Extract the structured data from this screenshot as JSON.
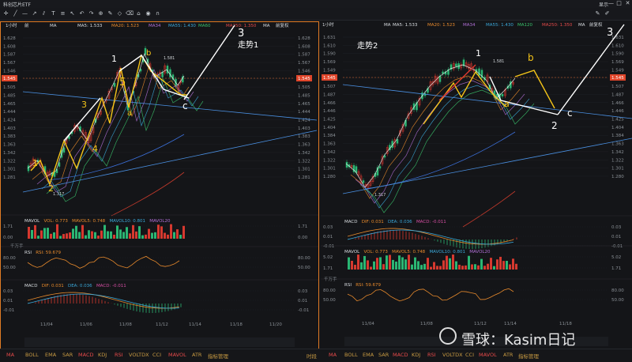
{
  "window": {
    "title": "科创芯片ETF",
    "right_label": "显示",
    "controls": [
      "—",
      "□",
      "✕"
    ]
  },
  "toolbar": {
    "icons": [
      "crosshair-icon",
      "line-icon",
      "horizontal-line-icon",
      "ray-icon",
      "parallel-icon",
      "text-icon",
      "fib-icon",
      "arrow-icon",
      "undo-icon",
      "redo-icon",
      "zoom-icon",
      "pen-icon",
      "shape-icon",
      "delete-icon",
      "lock-icon",
      "eye-icon",
      "magnet-icon"
    ]
  },
  "left": {
    "period": "1小时",
    "adj": "前",
    "ma_label": "MA",
    "ma5": "MA5: 1.533",
    "ma20": "MA20: 1.523",
    "ma34": "MA34",
    "ma55": "MA55: 1.430",
    "ma60": "MA60",
    "ma250": "MA250: 1.350",
    "ma_adj": "MA",
    "adj_label": "前复权",
    "title": "走势1",
    "price_ticks": [
      "1.628",
      "1.608",
      "1.587",
      "1.567",
      "1.546",
      "1.526",
      "1.505",
      "1.485",
      "1.465",
      "1.444",
      "1.424",
      "1.403",
      "1.383",
      "1.363",
      "1.342",
      "1.322",
      "1.301",
      "1.281"
    ],
    "last_price": "1.545",
    "high_label": "1.581",
    "low_label": "1.317",
    "wave_labels": [
      "1",
      "2",
      "3",
      "4",
      "5",
      "a",
      "b",
      "c",
      "3"
    ],
    "mavol": {
      "name": "MAVOL",
      "vol": "VOL: 0.773",
      "ma5": "MAVOL5: 0.748",
      "ma10": "MAVOL10: 0.801",
      "ma20": "MAVOL20",
      "ticks": [
        "1.71",
        "0.00"
      ],
      "unit": "千万手"
    },
    "rsi": {
      "name": "RSI",
      "value": "RSI: 59.679",
      "ticks": [
        "80.00",
        "50.00"
      ]
    },
    "macd": {
      "name": "MACD",
      "dif": "DIF: 0.031",
      "dea": "DEA: 0.036",
      "macd": "MACD: -0.011",
      "ticks": [
        "0.03",
        "0.01",
        "-0.01"
      ]
    },
    "dates": [
      "11/04",
      "11/06",
      "11/08",
      "11/12",
      "11/14",
      "11/18",
      "11/20"
    ],
    "years": [
      "2023",
      "2024"
    ]
  },
  "right": {
    "period": "1小时",
    "ma_label": "MA",
    "ma5": "MA5: 1.533",
    "ma20": "MA20: 1.523",
    "ma34": "MA34",
    "ma55": "MA55: 1.430",
    "ma60": "MA120",
    "ma250": "MA250: 1.350",
    "ma_adj": "MA",
    "adj_label": "前复权",
    "title": "走势2",
    "price_ticks": [
      "1.631",
      "1.610",
      "1.590",
      "1.569",
      "1.549",
      "1.528",
      "1.507",
      "1.487",
      "1.466",
      "1.446",
      "1.425",
      "1.404",
      "1.384",
      "1.363",
      "1.342",
      "1.322",
      "1.301",
      "1.280"
    ],
    "last_price": "1.545",
    "high_label": "1.581",
    "low_label": "1.317",
    "wave_labels": [
      "1",
      "a",
      "b",
      "c",
      "2",
      "3"
    ],
    "macd": {
      "name": "MACD",
      "dif": "DIF: 0.031",
      "dea": "DEA: 0.036",
      "macd": "MACD: -0.011",
      "ticks": [
        "0.03",
        "0.01",
        "-0.01"
      ]
    },
    "mavol": {
      "name": "MAVOL",
      "vol": "VOL: 0.773",
      "ma5": "MAVOL5: 0.748",
      "ma10": "MAVOL10: 0.801",
      "ma20": "MAVOL20",
      "ticks": [
        "5.02",
        "1.71"
      ],
      "unit": "千万手"
    },
    "rsi": {
      "name": "RSI",
      "value": "RSI: 59.679",
      "ticks": [
        "80.00",
        "50.00"
      ]
    },
    "dates": [
      "11/04",
      "11/08",
      "11/12",
      "11/14",
      "11/18"
    ],
    "years": [
      "2023"
    ]
  },
  "bottom": {
    "items": [
      "MA",
      "BOLL",
      "EMA",
      "SAR",
      "MACD",
      "KDJ",
      "RSI",
      "VOLTDX",
      "CCI",
      "MAVOL",
      "ATR",
      "指标管理"
    ],
    "right_label": "时段"
  },
  "watermark": "雪球：Kasim日记"
}
